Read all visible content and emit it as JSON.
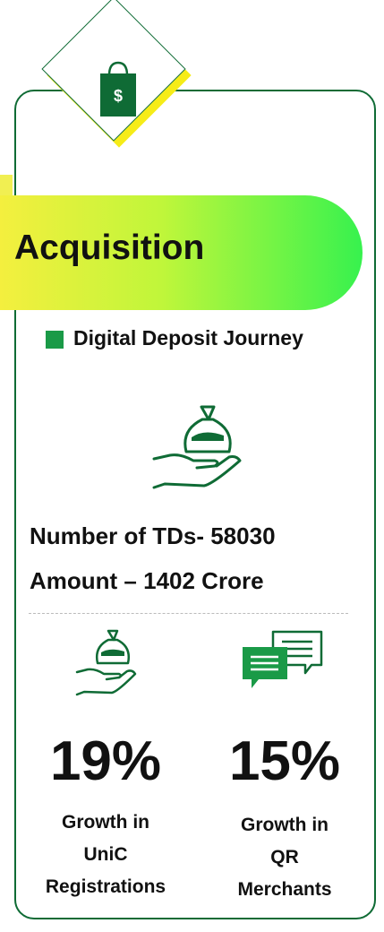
{
  "heading": {
    "title": "Acquisition"
  },
  "section": {
    "bullet": "Digital Deposit Journey"
  },
  "stats": {
    "line1": "Number of TDs- 58030",
    "line2": "Amount – 1402 Crore"
  },
  "metrics": [
    {
      "value": "19%",
      "label_lines": [
        "Growth in",
        "UniC",
        "Registrations"
      ]
    },
    {
      "value": "15%",
      "label_lines": [
        "Growth in",
        "QR",
        "Merchants"
      ]
    }
  ],
  "icons": {
    "top": "shopping-bag-dollar-icon",
    "deposit": "money-bag-hand-icon",
    "chat": "chat-bubbles-icon"
  },
  "bag_symbol": "$",
  "colors": {
    "primary_green": "#0f6b35",
    "accent_green": "#1a9a47",
    "yellow": "#f6ec18"
  }
}
